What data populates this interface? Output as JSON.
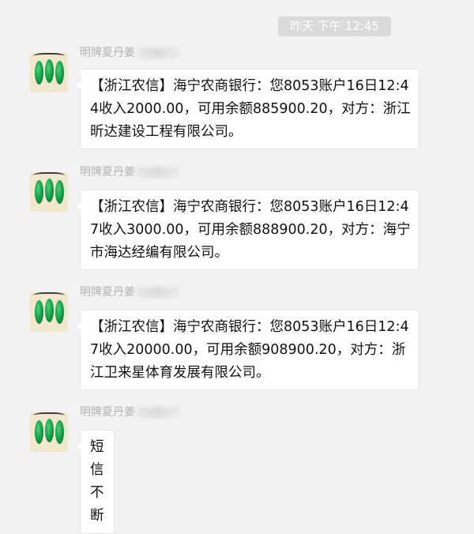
{
  "timestamp": "昨天 下午 12:45",
  "messages": [
    {
      "sender": "明牌夏丹姜",
      "text": "【浙江农信】海宁农商银行：您8053账户16日12:44收入2000.00，可用余额885900.20，对方：浙江昕达建设工程有限公司。"
    },
    {
      "sender": "明牌夏丹姜",
      "text": "【浙江农信】海宁农商银行：您8053账户16日12:47收入3000.00，可用余额888900.20，对方：海宁市海达经编有限公司。"
    },
    {
      "sender": "明牌夏丹姜",
      "text": "【浙江农信】海宁农商银行：您8053账户16日12:47收入20000.00，可用余额908900.20，对方：浙江卫来星体育发展有限公司。"
    },
    {
      "sender": "明牌夏丹姜",
      "text": "短信不断"
    }
  ],
  "colors": {
    "background": "#f2f2f2",
    "bubble": "#ffffff",
    "timestamp_bg": "#dadada",
    "sender_text": "#b2b2b2"
  }
}
